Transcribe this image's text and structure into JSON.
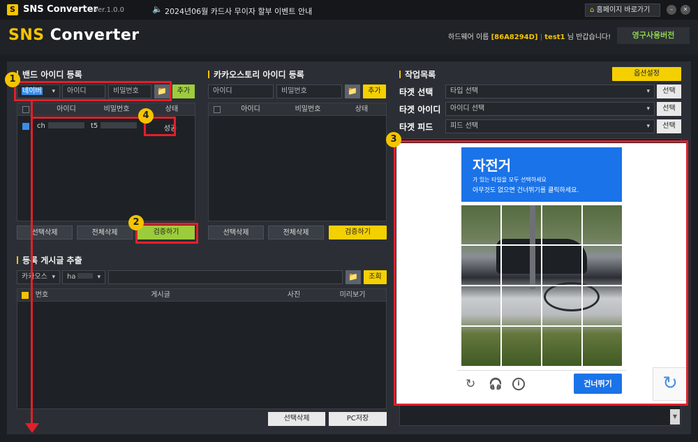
{
  "titlebar": {
    "logo_letter": "S",
    "app_name": "SNS Converter",
    "version": "Ver.1.0.0",
    "notice": "2024년06월 카드사 무이자 할부 이벤트 안내",
    "home_label": "홈페이지 바로가기",
    "minimize": "–",
    "close": "✕"
  },
  "header": {
    "brand": "SNS Converter",
    "hw_label": "하드웨어 이름",
    "hw_id": "[86A8294D]",
    "user": "test1",
    "greeting": "님 반갑습니다!",
    "license": "영구사용버전"
  },
  "band": {
    "title": "밴드 아이디 등록",
    "platform": "네이버",
    "id_placeholder": "아이디",
    "pw_placeholder": "비밀번호",
    "add_label": "추가",
    "columns": [
      "아이디",
      "비밀번호",
      "상태"
    ],
    "rows": [
      {
        "id": "ch",
        "pw": "t5",
        "status": "성공"
      }
    ],
    "delete_selected": "선택삭제",
    "delete_all": "전체삭제",
    "verify": "검증하기"
  },
  "kakao": {
    "title": "카카오스토리 아이디 등록",
    "id_placeholder": "아이디",
    "pw_placeholder": "비밀번호",
    "add_label": "추가",
    "columns": [
      "아이디",
      "비밀번호",
      "상태"
    ],
    "delete_selected": "선택삭제",
    "delete_all": "전체삭제",
    "verify": "검증하기"
  },
  "extract": {
    "title": "등록 게시글 추출",
    "source": "카카오스",
    "account": "ha",
    "search_label": "조회",
    "columns": [
      "번호",
      "게시글",
      "사진",
      "미리보기"
    ],
    "delete_selected": "선택삭제",
    "save_pc": "PC저장"
  },
  "work": {
    "title": "작업목록",
    "options": "옵션설정",
    "target_select_label": "타겟 선택",
    "target_select_value": "타입 선택",
    "target_id_label": "타겟 아이디",
    "target_id_value": "아이디 선택",
    "target_feed_label": "타겟 피드",
    "target_feed_value": "피드 선택",
    "choose": "선택"
  },
  "captcha": {
    "title": "자전거",
    "line1": "가 있는 타일을 모두 선택하세요",
    "line2": "아무것도 없으면 건너뛰기를 클릭하세요.",
    "skip": "건너뛰기"
  },
  "markers": [
    "1",
    "2",
    "3",
    "4"
  ],
  "colors": {
    "accent": "#f5d000",
    "green": "#9ccc3c",
    "red": "#e1202a",
    "captcha_blue": "#1a73e8"
  }
}
